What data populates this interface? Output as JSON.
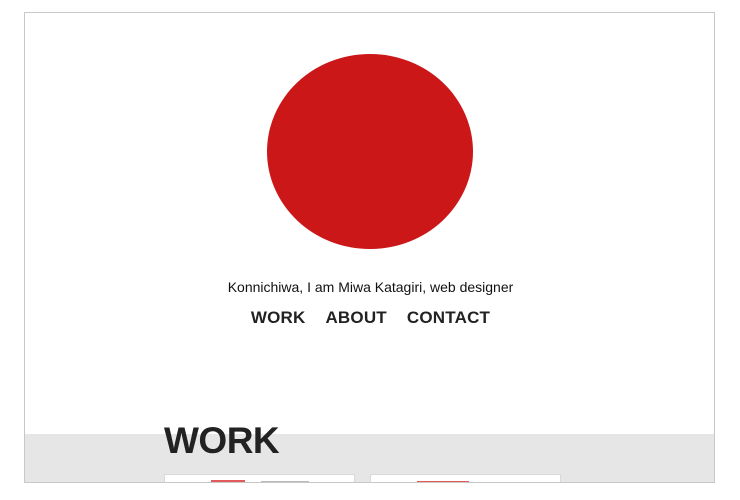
{
  "hero": {
    "circle_color": "#cc1719",
    "tagline": "Konnichiwa, I am Miwa Katagiri, web designer"
  },
  "nav": {
    "items": [
      {
        "label": "WORK"
      },
      {
        "label": "ABOUT"
      },
      {
        "label": "CONTACT"
      }
    ]
  },
  "work": {
    "title": "WORK",
    "thumbnails": [
      {
        "caption": ""
      },
      {
        "caption": ""
      }
    ]
  }
}
